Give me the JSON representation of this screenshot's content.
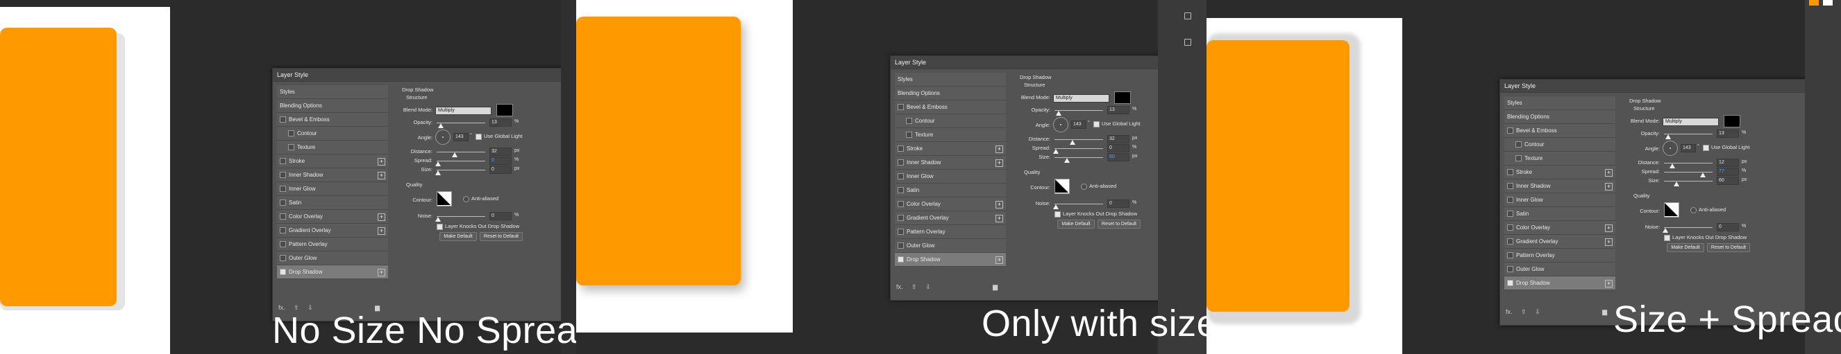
{
  "captions": {
    "panel1": "No Size No Spread",
    "panel2": "Only with size",
    "panel3": "Size + Spread"
  },
  "colors": {
    "orange": "#ff9900",
    "dialog_bg": "#535353",
    "canvas": "#ffffff"
  },
  "dialog": {
    "title": "Layer Style",
    "styles_header": "Styles",
    "blending_options": "Blending Options",
    "list": [
      {
        "label": "Bevel & Emboss",
        "checkbox": true,
        "plus": false,
        "sub": false
      },
      {
        "label": "Contour",
        "checkbox": true,
        "plus": false,
        "sub": true
      },
      {
        "label": "Texture",
        "checkbox": true,
        "plus": false,
        "sub": true
      },
      {
        "label": "Stroke",
        "checkbox": true,
        "plus": true,
        "sub": false
      },
      {
        "label": "Inner Shadow",
        "checkbox": true,
        "plus": true,
        "sub": false
      },
      {
        "label": "Inner Glow",
        "checkbox": true,
        "plus": false,
        "sub": false
      },
      {
        "label": "Satin",
        "checkbox": true,
        "plus": false,
        "sub": false
      },
      {
        "label": "Color Overlay",
        "checkbox": true,
        "plus": true,
        "sub": false
      },
      {
        "label": "Gradient Overlay",
        "checkbox": true,
        "plus": true,
        "sub": false
      },
      {
        "label": "Pattern Overlay",
        "checkbox": true,
        "plus": false,
        "sub": false
      },
      {
        "label": "Outer Glow",
        "checkbox": true,
        "plus": false,
        "sub": false
      },
      {
        "label": "Drop Shadow",
        "checkbox": true,
        "plus": true,
        "sub": false,
        "checked": true,
        "selected": true
      }
    ],
    "footer": {
      "fx": "fx.",
      "up": "⇧",
      "down": "⇩",
      "trash": "🗑"
    },
    "drop_shadow": {
      "title": "Drop Shadow",
      "structure": "Structure",
      "blend_mode_label": "Blend Mode:",
      "blend_mode_value": "Multiply",
      "opacity_label": "Opacity:",
      "angle_label": "Angle:",
      "angle_value": "143",
      "angle_unit": "°",
      "use_global_light": "Use Global Light",
      "distance_label": "Distance:",
      "spread_label": "Spread:",
      "size_label": "Size:",
      "quality": "Quality",
      "contour_label": "Contour:",
      "anti_aliased": "Anti-aliased",
      "noise_label": "Noise:",
      "noise_value": "0",
      "knocks_out": "Layer Knocks Out Drop Shadow",
      "make_default": "Make Default",
      "reset_default": "Reset to Default",
      "unit_pct": "%",
      "unit_px": "px"
    },
    "values": {
      "panel1": {
        "opacity": "13",
        "distance": "32",
        "spread": "0",
        "size": "0"
      },
      "panel2": {
        "opacity": "13",
        "distance": "32",
        "spread": "0",
        "size": "60"
      },
      "panel3": {
        "opacity": "13",
        "distance": "12",
        "spread": "77",
        "size": "60"
      }
    }
  }
}
